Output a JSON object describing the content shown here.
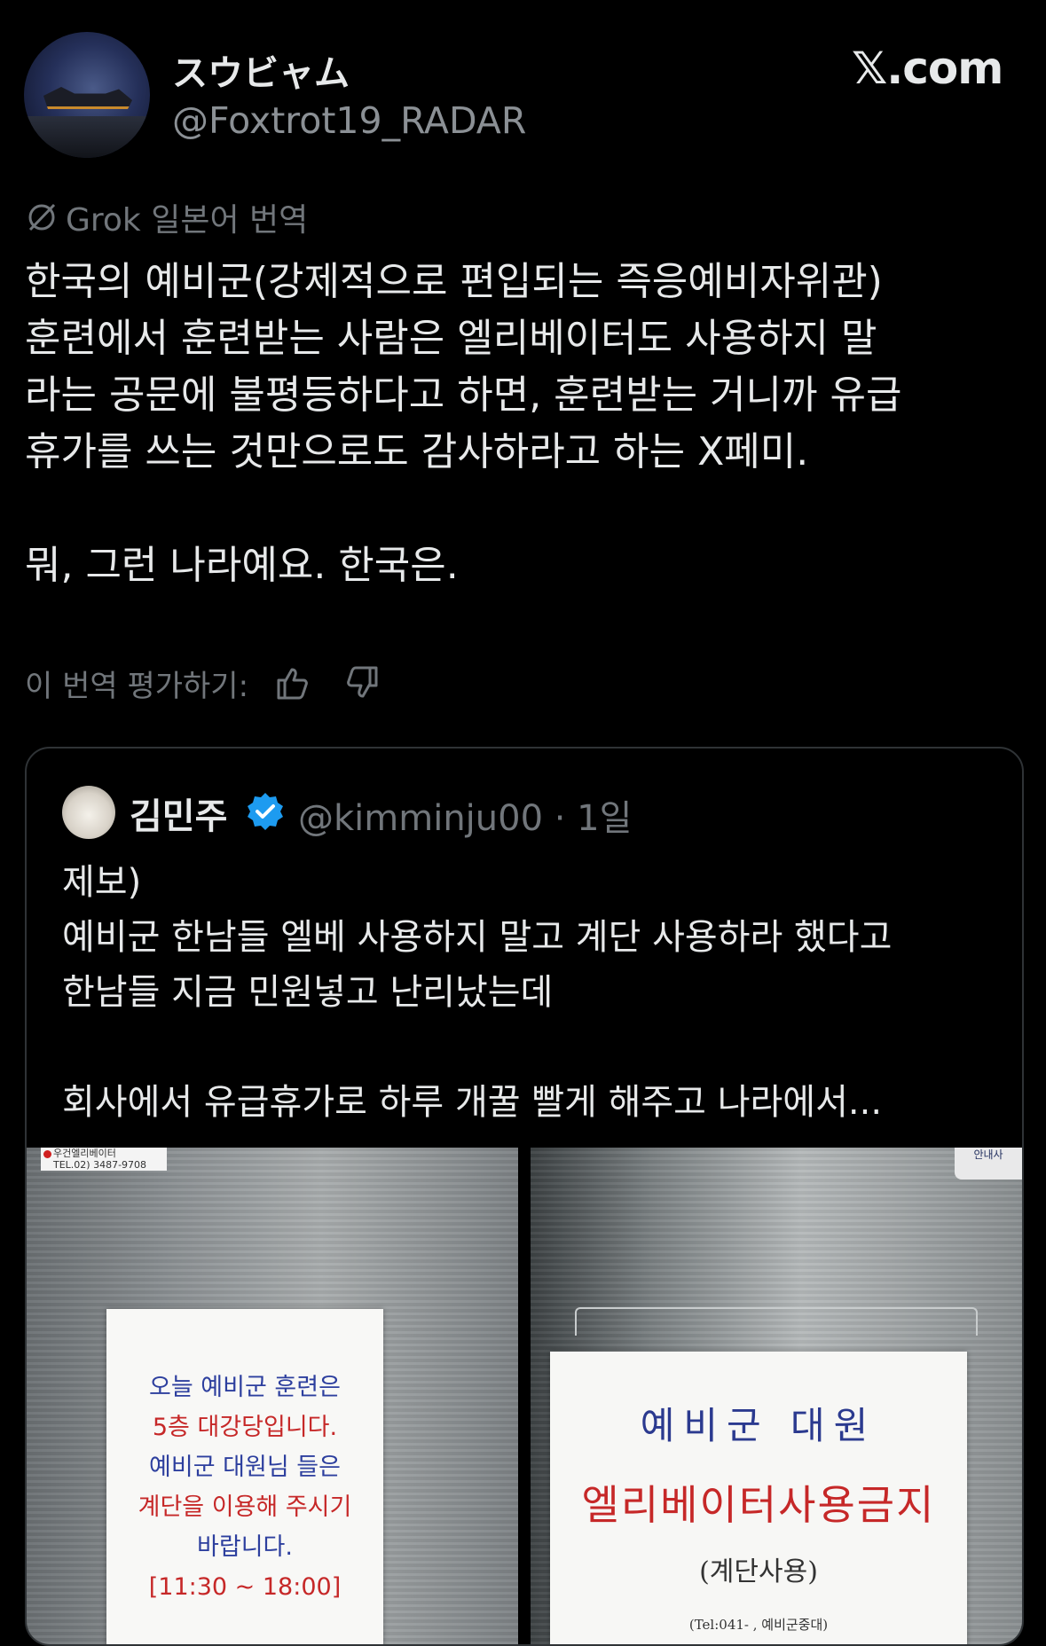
{
  "header": {
    "display_name": "スウビャム",
    "handle": "@Foxtrot19_RADAR",
    "brand": "𝕏.com"
  },
  "translation": {
    "label": "Grok 일본어 번역",
    "text": "한국의 예비군(강제적으로 편입되는 즉응예비자위관)\n훈련에서 훈련받는 사람은 엘리베이터도 사용하지 말\n라는 공문에 불평등하다고 하면, 훈련받는 거니까 유급\n휴가를 쓰는 것만으로도 감사하라고 하는 X페미.\n\n뭐, 그런 나라예요. 한국은.",
    "rate_label": "이 번역 평가하기:",
    "icons": [
      "slash-circle-icon",
      "thumbs-up-icon",
      "thumbs-down-icon"
    ]
  },
  "quote": {
    "name": "김민주",
    "handle": "@kimminju00 · 1일",
    "text": "제보)\n예비군 한남들 엘베 사용하지 말고 계단 사용하라 했다고\n한남들 지금 민원넣고 난리났는데\n\n회사에서 유급휴가로 하루 개꿀 빨게 해주고 나라에서...",
    "verified_color": "#1d9bf0",
    "photo_left": {
      "sticker": "우건엘리베이터",
      "sticker_tel": "TEL.02) 3487-9708",
      "lines": [
        {
          "text": "오늘 예비군 훈련은",
          "color": "blue"
        },
        {
          "text": "5층 대강당입니다.",
          "color": "red"
        },
        {
          "text": "예비군 대원님 들은",
          "color": "blue"
        },
        {
          "text": "계단을 이용해 주시기",
          "color": "red"
        },
        {
          "text": "바랍니다.",
          "color": "blue"
        },
        {
          "text": "[11:30 ~ 18:00]",
          "color": "red"
        }
      ]
    },
    "photo_right": {
      "tag": "안내사",
      "line1": "예비군 대원",
      "line2": "엘리베이터사용금지",
      "line3": "(계단사용)",
      "line4": "(Tel:041-          ,          예비군중대)"
    }
  }
}
